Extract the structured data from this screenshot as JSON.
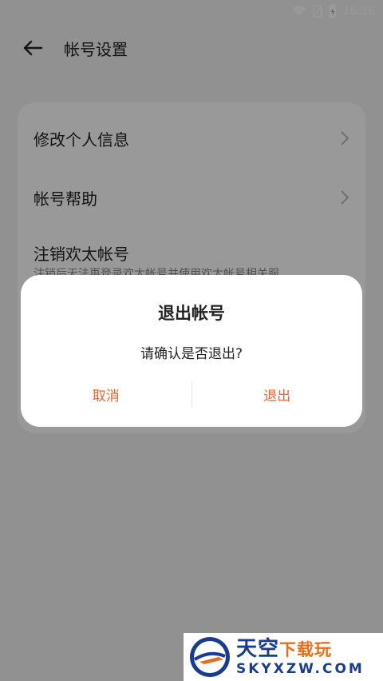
{
  "status_bar": {
    "time": "16:18"
  },
  "header": {
    "title": "帐号设置"
  },
  "menu": {
    "items": [
      {
        "label": "修改个人信息"
      },
      {
        "label": "帐号帮助"
      },
      {
        "label": "注销欢太帐号",
        "subtitle": "注销后无法再登录欢太帐号并使用欢太帐号相关服"
      }
    ]
  },
  "dialog": {
    "title": "退出帐号",
    "message": "请确认是否退出?",
    "cancel_label": "取消",
    "confirm_label": "退出",
    "accent_color": "#e8652f"
  },
  "watermark": {
    "name_part1": "天空",
    "name_part2": "下载玩",
    "domain": "SKYXZW.COM"
  }
}
